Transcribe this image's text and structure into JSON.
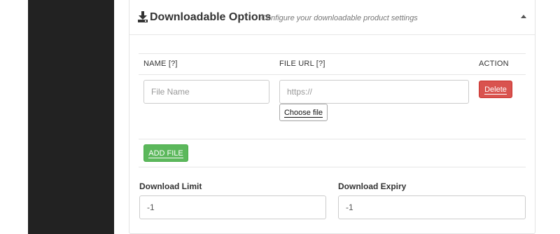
{
  "panel": {
    "title": "Downloadable Options",
    "subtitle": "Configure your downloadable product settings",
    "icon": "download-icon",
    "collapse_icon": "caret-up-icon"
  },
  "files_table": {
    "columns": [
      "NAME [?]",
      "FILE URL [?]",
      "ACTION"
    ],
    "rows": [
      {
        "name_value": "",
        "name_placeholder": "File Name",
        "url_value": "",
        "url_placeholder": "https://",
        "choose_label": "Choose file",
        "delete_label": "Delete"
      }
    ],
    "add_label": "ADD FILE"
  },
  "download_limit": {
    "label": "Download Limit",
    "value": "-1"
  },
  "download_expiry": {
    "label": "Download Expiry",
    "value": "-1"
  },
  "colors": {
    "sidebar": "#222222",
    "delete": "#d9534f",
    "add": "#5cb85c"
  }
}
